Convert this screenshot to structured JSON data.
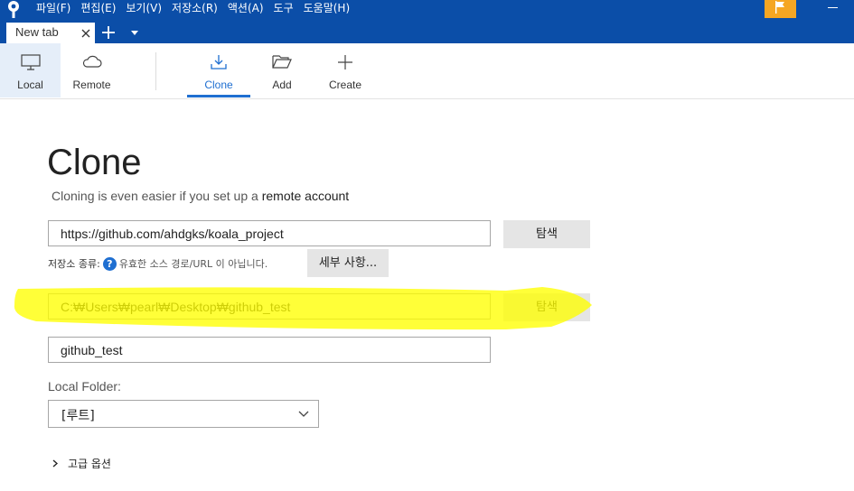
{
  "menu": [
    "파일(F)",
    "편집(E)",
    "보기(V)",
    "저장소(R)",
    "액션(A)",
    "도구",
    "도움말(H)"
  ],
  "tab": {
    "label": "New tab"
  },
  "toolbar": {
    "local": "Local",
    "remote": "Remote",
    "clone": "Clone",
    "add": "Add",
    "create": "Create"
  },
  "clone": {
    "title": "Clone",
    "subtitle_prefix": "Cloning is even easier if you set up a ",
    "subtitle_link": "remote account",
    "source_url": "https://github.com/ahdgks/koala_project",
    "browse_label": "탐색",
    "repo_type_label": "저장소 종류:",
    "repo_type_status": "유효한 소스 경로/URL 이 아닙니다.",
    "details_label": "세부 사항...",
    "destination_path": "C:₩Users₩pearl₩Desktop₩github_test",
    "name": "github_test",
    "local_folder_label": "Local Folder:",
    "local_folder_value": "[루트]",
    "advanced_label": "고급 옵션"
  },
  "colors": {
    "menubar": "#0b4ea8",
    "accent": "#1f6fd1",
    "flag": "#f5a623",
    "highlight": "#ffff00"
  }
}
